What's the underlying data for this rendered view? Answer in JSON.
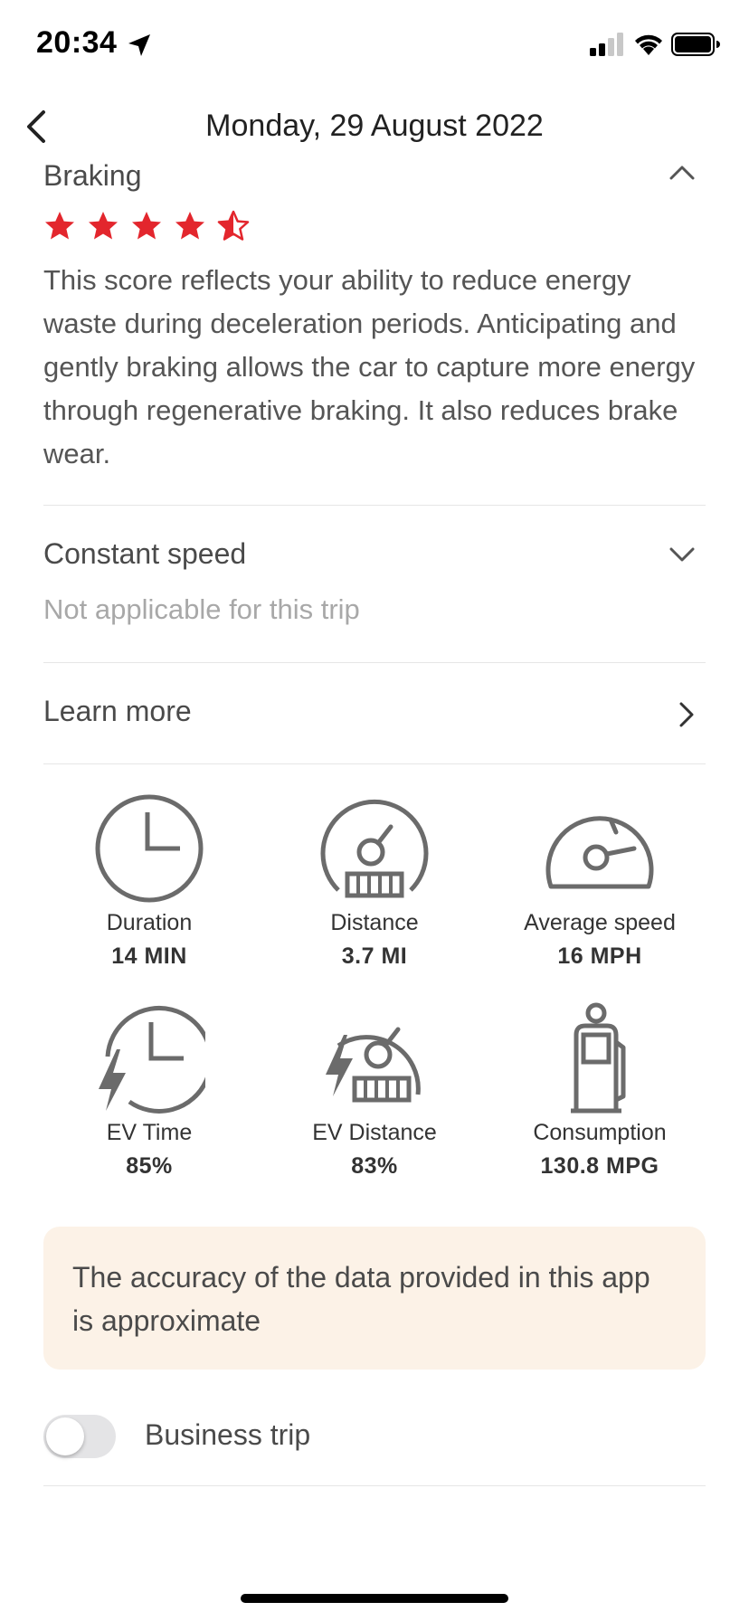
{
  "status_bar": {
    "time": "20:34"
  },
  "header": {
    "title": "Monday, 29 August 2022"
  },
  "braking": {
    "title": "Braking",
    "rating": 4.5,
    "rating_max": 5,
    "description": "This score reflects your ability to reduce energy waste during deceleration periods. Anticipating and gently braking allows the car to capture more energy through regenerative braking. It also reduces brake wear."
  },
  "constant_speed": {
    "title": "Constant speed",
    "note": "Not applicable for this trip"
  },
  "learn_more": {
    "label": "Learn more"
  },
  "stats": [
    {
      "icon": "clock-icon",
      "label": "Duration",
      "value": "14 MIN"
    },
    {
      "icon": "odometer-icon",
      "label": "Distance",
      "value": "3.7 MI"
    },
    {
      "icon": "speedometer-icon",
      "label": "Average speed",
      "value": "16 MPH"
    },
    {
      "icon": "ev-clock-icon",
      "label": "EV Time",
      "value": "85%"
    },
    {
      "icon": "ev-odometer-icon",
      "label": "EV Distance",
      "value": "83%"
    },
    {
      "icon": "fuel-pump-icon",
      "label": "Consumption",
      "value": "130.8 MPG"
    }
  ],
  "notice": {
    "text": "The accuracy of the data provided in this app is approximate"
  },
  "business_trip": {
    "label": "Business trip",
    "enabled": false
  },
  "colors": {
    "star": "#e3262d",
    "notice_bg": "#fcf2e7",
    "icon": "#6b6b6b"
  }
}
